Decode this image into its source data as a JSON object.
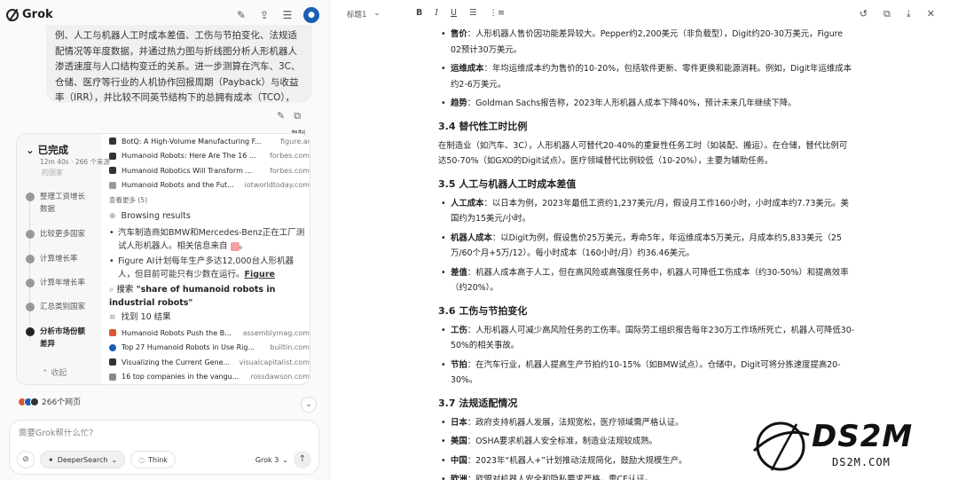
{
  "app": {
    "name": "Grok"
  },
  "chat": {
    "message": "例、人工与机器人工时成本差值、工伤与节拍变化、法规适配情况等年度数据，并通过热力图与折线图分析人形机器人渗透速度与人口结构变迁的关系。进一步测算在汽车、3C、仓储、医疗等行业的人机协作回报周期（Payback）与收益率（IRR），并比较不同英节结构下的总拥有成本（TCO），提出关键场景下的落地窗口与改造优先策略。",
    "copy_tooltip": "复制",
    "status_title": "已完成",
    "status_sub": "12m 40s · 266 个来源",
    "faded_label": "的国家",
    "steps": [
      "整理工资增长数据",
      "比较更多国家",
      "计算增长率",
      "计算年增长率",
      "汇总类别国家",
      "分析市场份额差异"
    ],
    "collapse": "收起",
    "sources_top": [
      {
        "title": "BotQ: A High-Volume Manufacturing F...",
        "domain": "figure.ai"
      },
      {
        "title": "Humanoid Robots: Here Are The 16 ...",
        "domain": "forbes.com"
      },
      {
        "title": "Humanoid Robotics Will Transform ...",
        "domain": "forbes.com"
      },
      {
        "title": "Humanoid Robots and the Fut...",
        "domain": "iotworldtoday.com"
      }
    ],
    "see_more": "查看更多 (5)",
    "browsing": "Browsing results",
    "bullet1": "汽车制造商如BMW和Mercedes-Benz正在工厂测试人形机器人。相关信息来自",
    "bullet2": "Figure AI计划每年生产多达12,000台人形机器人，但目前可能只有少数在运行。",
    "bullet2_link": "Figure",
    "search_prefix": "搜索",
    "search_query": "\"share of humanoid robots in industrial robots\"",
    "found": "找到 10 结果",
    "sources_bottom": [
      {
        "title": "Humanoid Robots Push the B...",
        "domain": "assemblymag.com"
      },
      {
        "title": "Top 27 Humanoid Robots in Use Rig...",
        "domain": "builtin.com"
      },
      {
        "title": "Visualizing the Current Gene...",
        "domain": "visualcapitalist.com"
      },
      {
        "title": "16 top companies in the vangu...",
        "domain": "rossdawson.com"
      }
    ],
    "web_count": "266个网页",
    "composer_placeholder": "需要Grok帮什么忙?",
    "deepersearch": "DeeperSearch",
    "think": "Think",
    "model": "Grok 3"
  },
  "editor": {
    "heading_select": "标题1",
    "blocks": [
      {
        "type": "li",
        "bold": "售价",
        "text": "：人形机器人售价因功能差异较大。Pepper约2,200美元（非负载型），Digit约20-30万美元，Figure 02预计30万美元。"
      },
      {
        "type": "li",
        "bold": "运维成本",
        "text": "：年均运维成本约为售价的10-20%，包括软件更新、零件更换和能源消耗。例如，Digit年运维成本约2-6万美元。"
      },
      {
        "type": "li",
        "bold": "趋势",
        "text": "：Goldman Sachs报告称，2023年人形机器人成本下降40%，预计未来几年继续下降。"
      },
      {
        "type": "h",
        "text": "3.4 替代性工时比例"
      },
      {
        "type": "p",
        "text": "在制造业（如汽车、3C），人形机器人可替代20-40%的重复性任务工时（如装配、搬运）。在仓储，替代比例可达50-70%（如GXO的Digit试点）。医疗领域替代比例较低（10-20%），主要为辅助任务。"
      },
      {
        "type": "h",
        "text": "3.5 人工与机器人工时成本差值"
      },
      {
        "type": "li",
        "bold": "人工成本",
        "text": "：以日本为例，2023年最低工资约1,237美元/月，假设月工作160小时，小时成本约7.73美元。美国约为15美元/小时。"
      },
      {
        "type": "li",
        "bold": "机器人成本",
        "text": "：以Digit为例，假设售价25万美元，寿命5年，年运维成本5万美元，月成本约5,833美元（25万/60个月+5万/12）。每小时成本（160小时/月）约36.46美元。"
      },
      {
        "type": "li",
        "bold": "差值",
        "text": "：机器人成本高于人工，但在高风险或高强度任务中，机器人可降低工伤成本（约30-50%）和提高效率（约20%）。"
      },
      {
        "type": "h",
        "text": "3.6 工伤与节拍变化"
      },
      {
        "type": "li",
        "bold": "工伤",
        "text": "：人形机器人可减少高风险任务的工伤率。国际劳工组织报告每年230万工作场所死亡，机器人可降低30-50%的相关事故。"
      },
      {
        "type": "li",
        "bold": "节拍",
        "text": "：在汽车行业，机器人提高生产节拍约10-15%（如BMW试点）。仓储中，Digit可将分拣速度提高20-30%。"
      },
      {
        "type": "h",
        "text": "3.7 法规适配情况"
      },
      {
        "type": "li",
        "bold": "日本",
        "text": "：政府支持机器人发展，法规宽松，医疗领域需严格认证。"
      },
      {
        "type": "li",
        "bold": "美国",
        "text": "：OSHA要求机器人安全标准，制造业法规较成熟。"
      },
      {
        "type": "li",
        "bold": "中国",
        "text": "：2023年“机器人+”计划推动法规简化，鼓励大规模生产。"
      },
      {
        "type": "li",
        "bold": "欧洲",
        "text": "：欧盟对机器人安全和隐私要求严格，需CE认证。"
      }
    ]
  },
  "watermark": {
    "logo": "DS2M",
    "sub": "DS2M.COM"
  }
}
